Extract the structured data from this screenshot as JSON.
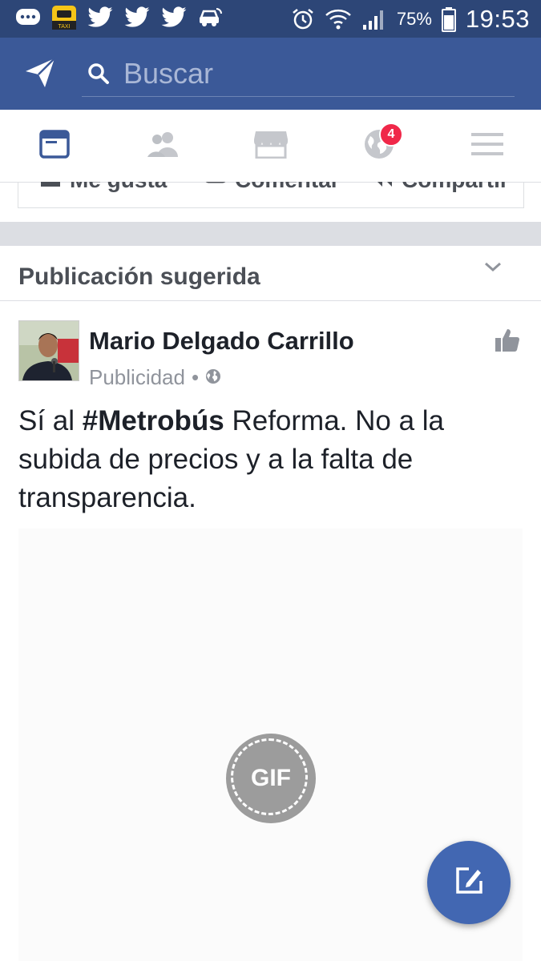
{
  "status_bar": {
    "battery_percent": "75%",
    "time": "19:53",
    "icons": [
      "messages-icon",
      "taxi-app-icon",
      "twitter-icon",
      "twitter-icon",
      "twitter-icon",
      "car-icon",
      "alarm-icon",
      "wifi-icon",
      "signal-icon",
      "battery-icon"
    ],
    "taxi_label": "TAXI"
  },
  "app_bar": {
    "search_placeholder": "Buscar"
  },
  "tabs": {
    "items": [
      "news-feed-tab",
      "friends-tab",
      "marketplace-tab",
      "notifications-tab",
      "menu-tab"
    ],
    "notifications_badge": "4",
    "active": "news-feed-tab"
  },
  "previous_post_actions": {
    "like": "Me gusta",
    "comment": "Comentar",
    "share": "Compartir"
  },
  "suggested": {
    "label": "Publicación sugerida"
  },
  "post": {
    "author": "Mario Delgado Carrillo",
    "meta": "Publicidad",
    "separator": "•",
    "text_before": "Sí al ",
    "hashtag": "#Metrobús",
    "text_after": " Reforma. No a la subida de precios y a la falta de transparencia.",
    "media_label": "GIF"
  },
  "colors": {
    "status_bar": "#2d4677",
    "app_bar": "#3b5998",
    "active_tab": "#3b5998",
    "badge": "#f02849",
    "fab": "#4267b2"
  }
}
